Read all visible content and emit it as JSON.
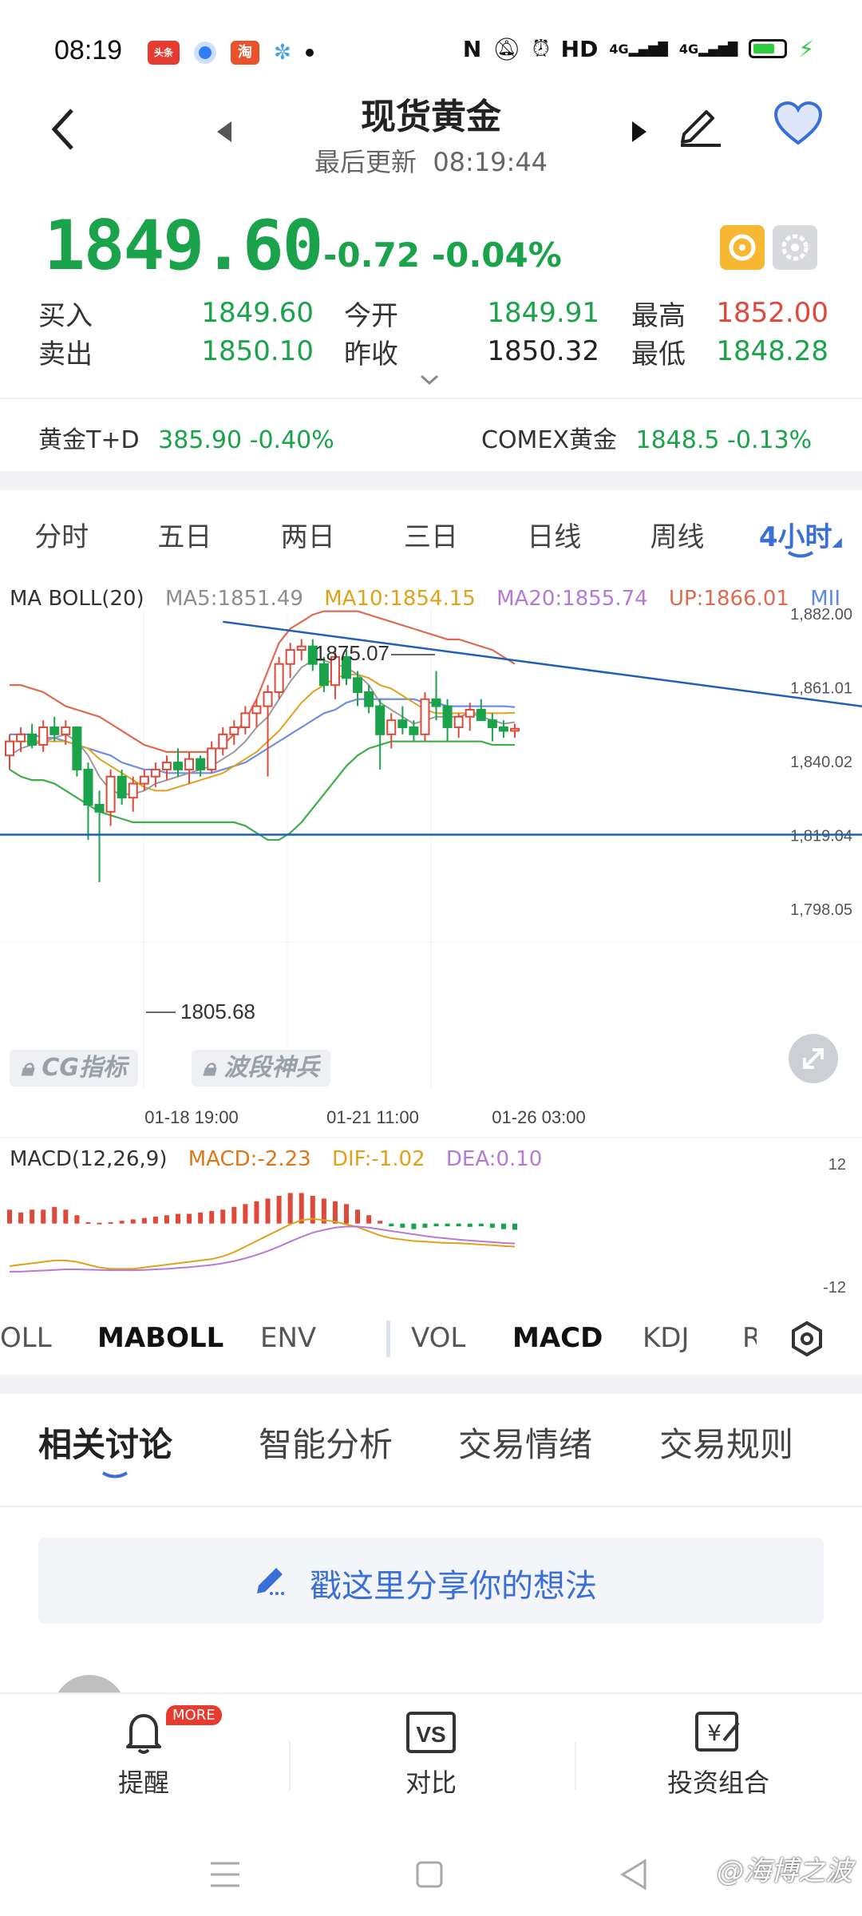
{
  "status_bar": {
    "time": "08:19",
    "app_icons": [
      "头条",
      "淘"
    ],
    "right_text": "HD",
    "network": "4G"
  },
  "header": {
    "title": "现货黄金",
    "last_update_label": "最后更新",
    "last_update_time": "08:19:44"
  },
  "quote": {
    "price": "1849.60",
    "change": "-0.72",
    "change_pct": "-0.04%",
    "buy_label": "买入",
    "buy": "1849.60",
    "sell_label": "卖出",
    "sell": "1850.10",
    "open_label": "今开",
    "open": "1849.91",
    "prev_close_label": "昨收",
    "prev_close": "1850.32",
    "high_label": "最高",
    "high": "1852.00",
    "low_label": "最低",
    "low": "1848.28"
  },
  "related": {
    "item1_name": "黄金T+D",
    "item1_price": "385.90",
    "item1_pct": "-0.40%",
    "item2_name": "COMEX黄金",
    "item2_price": "1848.5",
    "item2_pct": "-0.13%"
  },
  "period_tabs": [
    "分时",
    "五日",
    "两日",
    "三日",
    "日线",
    "周线",
    "4小时"
  ],
  "active_period": "4小时",
  "chart_legend": {
    "name": "MA BOLL(20)",
    "ma5": "MA5:1851.49",
    "ma10": "MA10:1854.15",
    "ma20": "MA20:1855.74",
    "up": "UP:1866.01",
    "mid": "MII"
  },
  "macd_legend": {
    "name": "MACD(12,26,9)",
    "macd": "MACD:-2.23",
    "dif": "DIF:-1.02",
    "dea": "DEA:0.10"
  },
  "lock_tags": [
    "CG指标",
    "波段神兵"
  ],
  "annotations": {
    "high": "1875.07",
    "low": "1805.68"
  },
  "chart_data": {
    "type": "candlestick",
    "y_ticks": [
      "1,882.00",
      "1,861.01",
      "1,840.02",
      "1,819.04",
      "1,798.05"
    ],
    "x_ticks": [
      "01-18 19:00",
      "01-21 11:00",
      "01-26 03:00"
    ],
    "macd_y_ticks": [
      "12",
      "-12"
    ],
    "ylim": [
      1798.05,
      1882.0
    ],
    "candles": [
      [
        1842,
        1848,
        1838,
        1846
      ],
      [
        1846,
        1850,
        1843,
        1848
      ],
      [
        1848,
        1851,
        1844,
        1845
      ],
      [
        1845,
        1852,
        1843,
        1850
      ],
      [
        1850,
        1853,
        1846,
        1848
      ],
      [
        1848,
        1852,
        1845,
        1850
      ],
      [
        1850,
        1850,
        1836,
        1838
      ],
      [
        1838,
        1840,
        1818,
        1828
      ],
      [
        1828,
        1832,
        1806,
        1826
      ],
      [
        1826,
        1838,
        1822,
        1836
      ],
      [
        1836,
        1838,
        1828,
        1830
      ],
      [
        1830,
        1836,
        1826,
        1834
      ],
      [
        1834,
        1838,
        1832,
        1836
      ],
      [
        1836,
        1840,
        1833,
        1838
      ],
      [
        1838,
        1842,
        1835,
        1840
      ],
      [
        1840,
        1844,
        1836,
        1838
      ],
      [
        1838,
        1843,
        1834,
        1841
      ],
      [
        1841,
        1842,
        1836,
        1838
      ],
      [
        1838,
        1846,
        1837,
        1844
      ],
      [
        1844,
        1850,
        1842,
        1848
      ],
      [
        1848,
        1852,
        1845,
        1850
      ],
      [
        1850,
        1856,
        1848,
        1854
      ],
      [
        1854,
        1858,
        1850,
        1856
      ],
      [
        1856,
        1862,
        1836,
        1860
      ],
      [
        1860,
        1870,
        1858,
        1868
      ],
      [
        1868,
        1874,
        1864,
        1872
      ],
      [
        1872,
        1875.07,
        1869,
        1873
      ],
      [
        1873,
        1875,
        1866,
        1868
      ],
      [
        1868,
        1870,
        1860,
        1862
      ],
      [
        1862,
        1872,
        1858,
        1870
      ],
      [
        1870,
        1872,
        1862,
        1864
      ],
      [
        1864,
        1866,
        1856,
        1860
      ],
      [
        1860,
        1862,
        1854,
        1856
      ],
      [
        1856,
        1858,
        1838,
        1848
      ],
      [
        1848,
        1854,
        1844,
        1852
      ],
      [
        1852,
        1856,
        1848,
        1850
      ],
      [
        1850,
        1852,
        1846,
        1848
      ],
      [
        1848,
        1860,
        1846,
        1858
      ],
      [
        1858,
        1866,
        1852,
        1856
      ],
      [
        1856,
        1858,
        1846,
        1850
      ],
      [
        1850,
        1854,
        1847,
        1853
      ],
      [
        1853,
        1857,
        1849,
        1855
      ],
      [
        1855,
        1858,
        1852,
        1852
      ],
      [
        1852,
        1854,
        1846,
        1850
      ],
      [
        1850,
        1852,
        1847,
        1849
      ],
      [
        1849,
        1851,
        1847,
        1849.6
      ]
    ],
    "ma5": [
      1842,
      1844,
      1845,
      1846,
      1847,
      1848,
      1846,
      1842,
      1836,
      1832,
      1831,
      1831,
      1832,
      1834,
      1835,
      1836,
      1837,
      1838,
      1839,
      1841,
      1843,
      1846,
      1850,
      1853,
      1858,
      1863,
      1867,
      1869,
      1869,
      1868,
      1867,
      1865,
      1862,
      1857,
      1855,
      1853,
      1851,
      1852,
      1853,
      1853,
      1853,
      1854,
      1853,
      1852,
      1851,
      1851.49
    ],
    "ma10": [
      1846,
      1846,
      1846,
      1846,
      1846,
      1846,
      1845,
      1844,
      1841,
      1839,
      1837,
      1835,
      1833,
      1832,
      1832,
      1833,
      1834,
      1835,
      1836,
      1837,
      1839,
      1841,
      1843,
      1846,
      1849,
      1853,
      1857,
      1860,
      1862,
      1864,
      1865,
      1865,
      1864,
      1862,
      1861,
      1859,
      1857,
      1855,
      1854,
      1854,
      1854,
      1854,
      1854,
      1854,
      1854,
      1854.15
    ],
    "ma20": [
      1848,
      1848,
      1848,
      1847,
      1847,
      1846,
      1845,
      1844,
      1843,
      1842,
      1840,
      1839,
      1838,
      1838,
      1837,
      1837,
      1837,
      1837,
      1837,
      1838,
      1839,
      1840,
      1842,
      1844,
      1846,
      1848,
      1850,
      1852,
      1854,
      1855,
      1857,
      1858,
      1858,
      1858,
      1858,
      1858,
      1858,
      1857,
      1857,
      1856,
      1856,
      1856,
      1856,
      1856,
      1856,
      1855.74
    ],
    "boll_up": [
      1862,
      1862,
      1861,
      1860,
      1858,
      1856,
      1855,
      1854,
      1853,
      1851,
      1849,
      1847,
      1845,
      1844,
      1843,
      1843,
      1843,
      1843,
      1843,
      1845,
      1848,
      1852,
      1858,
      1866,
      1874,
      1878,
      1880,
      1882,
      1883,
      1883,
      1883,
      1883,
      1882,
      1881,
      1880,
      1879,
      1878,
      1877,
      1876,
      1875,
      1875,
      1874,
      1873,
      1872,
      1870,
      1868
    ],
    "boll_lo": [
      1838,
      1836,
      1835,
      1835,
      1834,
      1832,
      1830,
      1828,
      1826,
      1825,
      1824,
      1823,
      1823,
      1823,
      1823,
      1823,
      1823,
      1823,
      1823,
      1823,
      1823,
      1822,
      1820,
      1818,
      1818,
      1820,
      1823,
      1827,
      1831,
      1835,
      1839,
      1842,
      1844,
      1845,
      1846,
      1846,
      1846,
      1846,
      1846,
      1846,
      1846,
      1846,
      1846,
      1845,
      1845,
      1845
    ],
    "trendline": {
      "from": [
        1,
        1880
      ],
      "to": [
        46,
        1861
      ]
    },
    "support": 1819.5,
    "macd_bars": [
      5,
      4,
      5,
      5,
      6,
      5,
      3,
      0.5,
      0.3,
      0.5,
      1,
      1.5,
      2,
      2.5,
      3,
      3.5,
      3.5,
      4,
      4.5,
      5,
      6,
      7,
      8,
      9,
      10,
      11,
      11,
      10,
      9,
      8,
      7,
      5,
      3,
      1,
      -1,
      -1.5,
      -2,
      -1.5,
      -1,
      -1,
      -1,
      -1.2,
      -1,
      -1.5,
      -2,
      -2.23
    ],
    "dif": [
      -8,
      -7.5,
      -7,
      -6.5,
      -6,
      -6,
      -6.5,
      -7.5,
      -8.5,
      -9,
      -9,
      -9,
      -8.5,
      -8,
      -7.5,
      -7,
      -6.5,
      -6,
      -5.5,
      -4.5,
      -3,
      -1,
      1,
      3,
      5,
      7,
      8.5,
      9,
      8.5,
      8,
      7,
      6,
      4.5,
      3,
      2,
      1.5,
      1,
      0.8,
      0.5,
      0.3,
      0.2,
      0,
      -0.3,
      -0.5,
      -0.8,
      -1.02
    ],
    "dea": [
      -10,
      -10,
      -9.8,
      -9.6,
      -9.4,
      -9.2,
      -9.2,
      -9.3,
      -9.4,
      -9.5,
      -9.5,
      -9.5,
      -9.4,
      -9.2,
      -9,
      -8.7,
      -8.4,
      -8,
      -7.6,
      -7,
      -6.2,
      -5.2,
      -4,
      -2.6,
      -1,
      0.8,
      2.5,
      4,
      5,
      5.8,
      6.2,
      6.2,
      5.8,
      5.2,
      4.6,
      4,
      3.4,
      2.8,
      2.3,
      1.9,
      1.5,
      1.2,
      0.9,
      0.6,
      0.3,
      0.1
    ]
  },
  "indicator_tabs": {
    "main": [
      "OLL",
      "MABOLL",
      "ENV"
    ],
    "sub": [
      "VOL",
      "MACD",
      "KDJ",
      "R"
    ]
  },
  "discussion_tabs": [
    "相关讨论",
    "智能分析",
    "交易情绪",
    "交易规则"
  ],
  "share_prompt": "戳这里分享你的想法",
  "bottom_nav": {
    "alert": "提醒",
    "more_badge": "MORE",
    "compare": "对比",
    "portfolio": "投资组合"
  },
  "watermark": "@海博之波",
  "colors": {
    "up": "#e0483a",
    "down": "#1aa34a",
    "accent": "#3a6fd8"
  }
}
